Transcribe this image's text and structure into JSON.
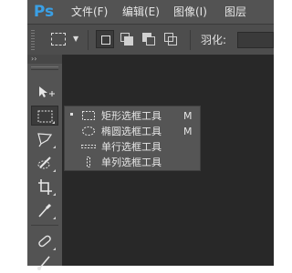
{
  "app": {
    "logo": "Ps"
  },
  "menubar": {
    "items": [
      {
        "label": "文件(F)"
      },
      {
        "label": "编辑(E)"
      },
      {
        "label": "图像(I)"
      },
      {
        "label": "图层"
      }
    ]
  },
  "options": {
    "feather_label": "羽化:",
    "feather_value": ""
  },
  "toolbar": {
    "header_label": "››",
    "tools": [
      {
        "name": "move-tool",
        "icon": "move-icon"
      },
      {
        "name": "rectangular-marquee-tool",
        "icon": "marquee-icon",
        "active": true
      },
      {
        "name": "lasso-tool",
        "icon": "lasso-icon"
      },
      {
        "name": "quick-selection-tool",
        "icon": "quick-selection-icon"
      },
      {
        "name": "crop-tool",
        "icon": "crop-icon"
      },
      {
        "name": "eyedropper-tool",
        "icon": "eyedropper-icon"
      },
      {
        "name": "spot-healing-tool",
        "icon": "bandage-icon"
      },
      {
        "name": "brush-tool",
        "icon": "brush-icon"
      }
    ]
  },
  "flyout": {
    "items": [
      {
        "label": "矩形选框工具",
        "shortcut": "M",
        "selected": true,
        "icon": "rect-marquee-icon"
      },
      {
        "label": "椭圆选框工具",
        "shortcut": "M",
        "selected": false,
        "icon": "ellipse-marquee-icon"
      },
      {
        "label": "单行选框工具",
        "shortcut": "",
        "selected": false,
        "icon": "single-row-marquee-icon"
      },
      {
        "label": "单列选框工具",
        "shortcut": "",
        "selected": false,
        "icon": "single-column-marquee-icon"
      }
    ]
  },
  "colors": {
    "menubar_bg": "#535353",
    "toolbar_bg": "#535353",
    "canvas_bg": "#282828",
    "flyout_bg": "#555555",
    "logo_blue": "#3aa0e6"
  }
}
